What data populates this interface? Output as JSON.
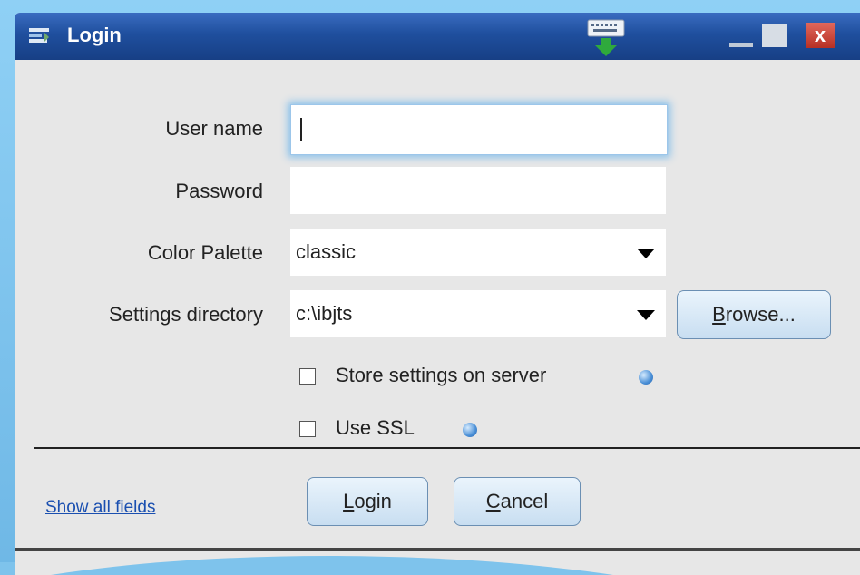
{
  "window": {
    "title": "Login",
    "icons": {
      "app": "app-icon",
      "keyboard": "keyboard-download-icon",
      "minimize": "minimize-icon",
      "maximize": "maximize-icon",
      "close": "close-icon"
    },
    "close_label": "x"
  },
  "form": {
    "username": {
      "label": "User name",
      "value": ""
    },
    "password": {
      "label": "Password",
      "value": ""
    },
    "color_palette": {
      "label": "Color Palette",
      "value": "classic"
    },
    "settings_directory": {
      "label": "Settings directory",
      "value": "c:\\ibjts"
    },
    "browse": {
      "mnemonic": "B",
      "rest": "rowse..."
    },
    "store_settings": {
      "label": "Store settings on server",
      "checked": false
    },
    "use_ssl": {
      "label": "Use SSL",
      "checked": false
    }
  },
  "footer": {
    "show_all_fields": "Show all fields",
    "login": {
      "mnemonic": "L",
      "rest": "ogin"
    },
    "cancel": {
      "mnemonic": "C",
      "rest": "ancel"
    }
  },
  "colors": {
    "titlebar": "#1f4f9e",
    "background": "#e7e7e7",
    "link": "#1a4fb0",
    "close_button": "#b73024"
  }
}
